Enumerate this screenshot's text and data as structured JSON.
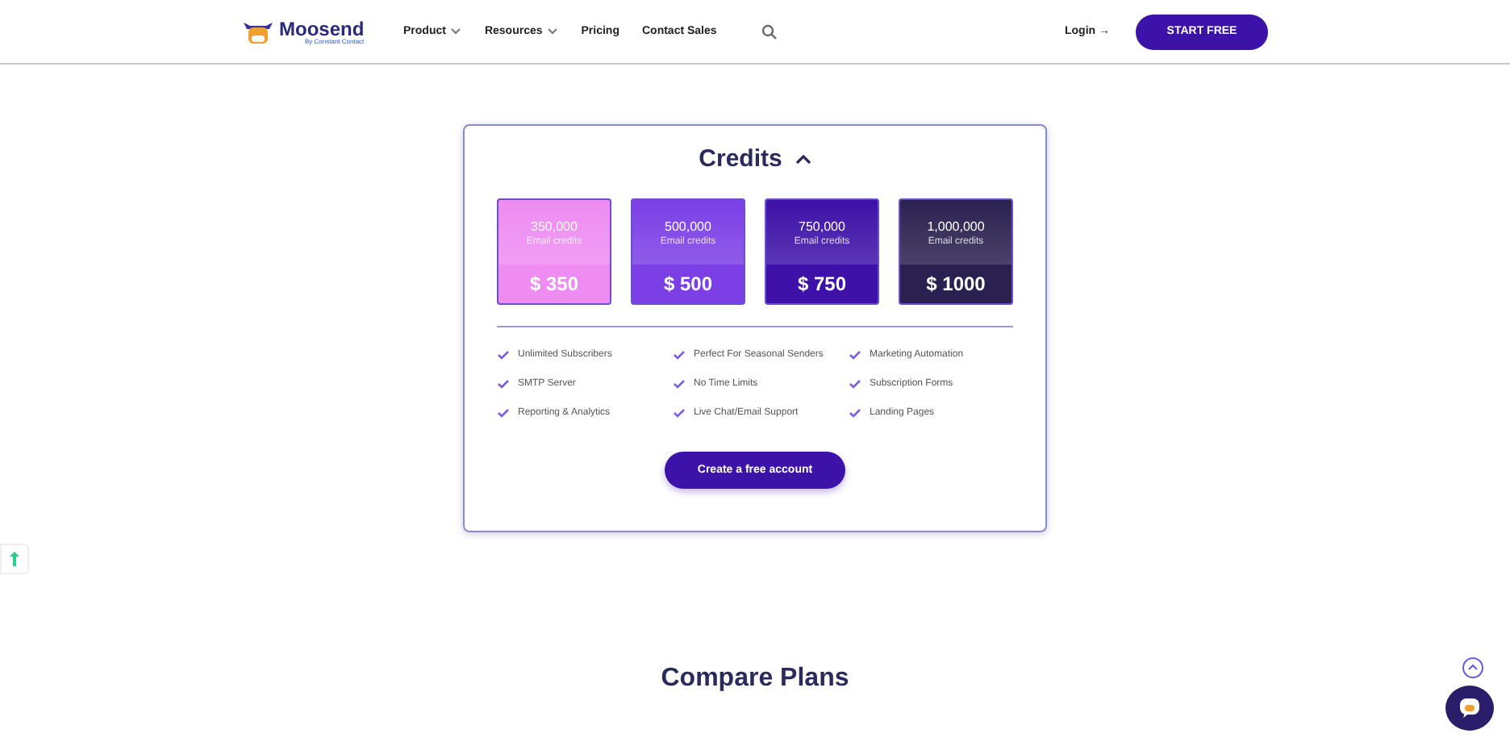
{
  "header": {
    "logo": {
      "name": "Moosend",
      "tagline": "By Constant Contact"
    },
    "nav": [
      {
        "label": "Product",
        "dropdown": true
      },
      {
        "label": "Resources",
        "dropdown": true
      },
      {
        "label": "Pricing",
        "dropdown": false
      },
      {
        "label": "Contact Sales",
        "dropdown": false
      }
    ],
    "login": "Login →",
    "cta": "START FREE"
  },
  "credits": {
    "title": "Credits",
    "expanded": true,
    "plans": [
      {
        "amount": "350,000",
        "unit": "Email credits",
        "price": "$ 350",
        "color": "#ee8cf2"
      },
      {
        "amount": "500,000",
        "unit": "Email credits",
        "price": "$ 500",
        "color": "#7c3fe6"
      },
      {
        "amount": "750,000",
        "unit": "Email credits",
        "price": "$ 750",
        "color": "#3e12a8"
      },
      {
        "amount": "1,000,000",
        "unit": "Email credits",
        "price": "$ 1000",
        "color": "#2b2150"
      }
    ],
    "features": [
      "Unlimited Subscribers",
      "Perfect For Seasonal Senders",
      "Marketing Automation",
      "SMTP Server",
      "No Time Limits",
      "Subscription Forms",
      "Reporting & Analytics",
      "Live Chat/Email Support",
      "Landing Pages"
    ],
    "button": "Create a free account"
  },
  "compare_title": "Compare Plans"
}
